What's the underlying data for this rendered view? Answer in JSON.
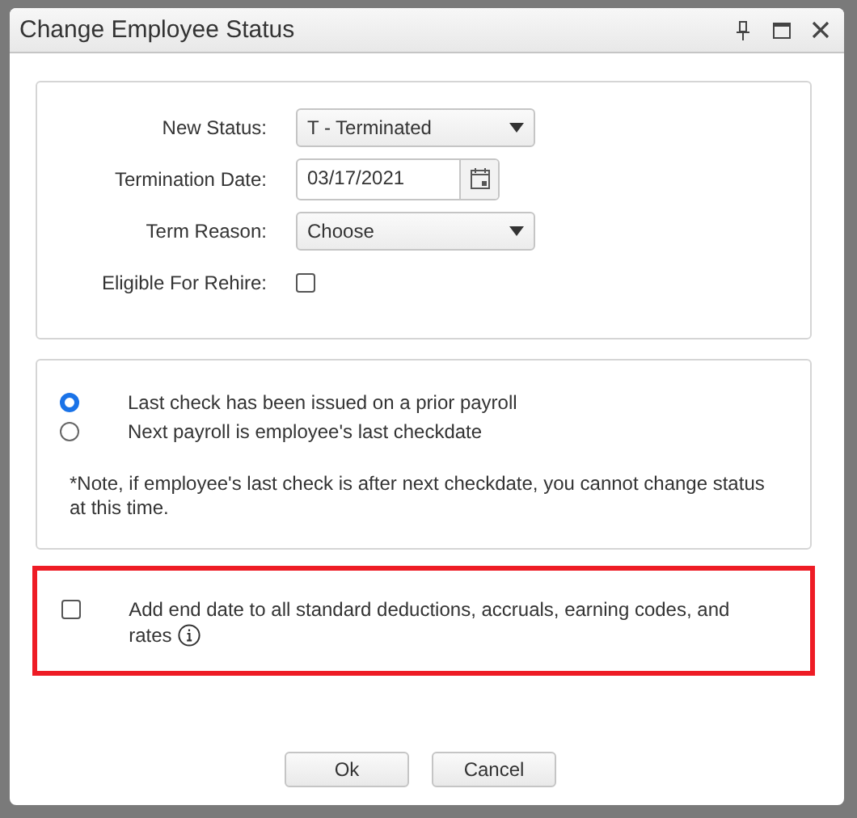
{
  "dialog": {
    "title": "Change Employee Status"
  },
  "fields": [
    {
      "kind": "select",
      "label": "New Status:",
      "value": "T - Terminated"
    },
    {
      "kind": "date",
      "label": "Termination Date:",
      "value": "03/17/2021"
    },
    {
      "kind": "select",
      "label": "Term Reason:",
      "value": "Choose"
    },
    {
      "kind": "checkbox",
      "label": "Eligible For Rehire:",
      "checked": false
    }
  ],
  "last_check_options": [
    {
      "label": "Last check has been issued on a prior payroll",
      "selected": true
    },
    {
      "label": "Next payroll is employee's last checkdate",
      "selected": false
    }
  ],
  "note": "*Note, if employee's last check is after next checkdate, you cannot change status at this time.",
  "end_date_option": {
    "label": "Add end date to all standard deductions, accruals, earning codes, and rates",
    "checked": false,
    "highlighted": true
  },
  "buttons": [
    "Ok",
    "Cancel"
  ]
}
